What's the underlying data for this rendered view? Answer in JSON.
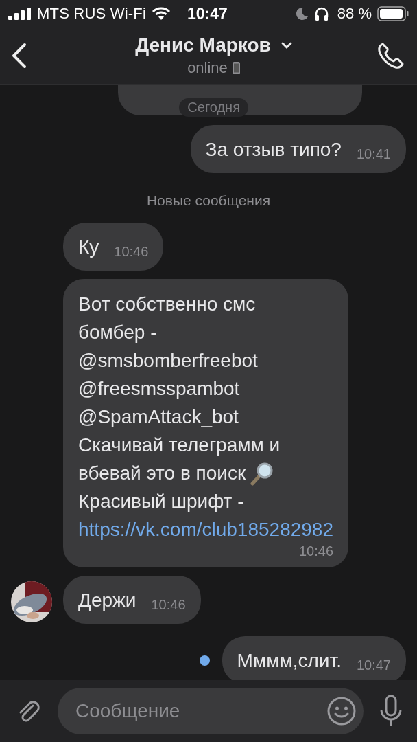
{
  "status_bar": {
    "carrier": "MTS RUS Wi-Fi",
    "time": "10:47",
    "battery": "88 %"
  },
  "header": {
    "title": "Денис Марков",
    "subtitle": "online"
  },
  "date_badge": "Сегодня",
  "messages": [
    {
      "kind": "out",
      "cut": true
    },
    {
      "kind": "out",
      "parts": [
        {
          "kind": "text",
          "text": "За отзыв типо?"
        }
      ],
      "time": "10:41"
    },
    {
      "kind": "divider",
      "label": "Новые сообщения"
    },
    {
      "kind": "in",
      "parts": [
        {
          "kind": "text",
          "text": "Ку"
        }
      ],
      "time": "10:46"
    },
    {
      "kind": "in",
      "block": true,
      "parts": [
        {
          "kind": "text",
          "text": "Вот собственно смс\nбомбер -\n@smsbomberfreebot\n@freesmsspambot\n@SpamAttack_bot\nСкачивай телеграмм и"
        },
        {
          "kind": "text",
          "text": "вбевай это в поиск"
        },
        {
          "kind": "icon"
        },
        {
          "kind": "text",
          "text": "Красивый шрифт -"
        },
        {
          "kind": "link",
          "text": "https://vk.com/club185282982"
        }
      ],
      "time": "10:46"
    },
    {
      "kind": "in",
      "avatar": true,
      "parts": [
        {
          "kind": "text",
          "text": "Держи"
        }
      ],
      "time": "10:46"
    },
    {
      "kind": "out",
      "unread": true,
      "parts": [
        {
          "kind": "text",
          "text": "Мммм,слит."
        }
      ],
      "time": "10:47"
    }
  ],
  "composer": {
    "placeholder": "Сообщение"
  }
}
